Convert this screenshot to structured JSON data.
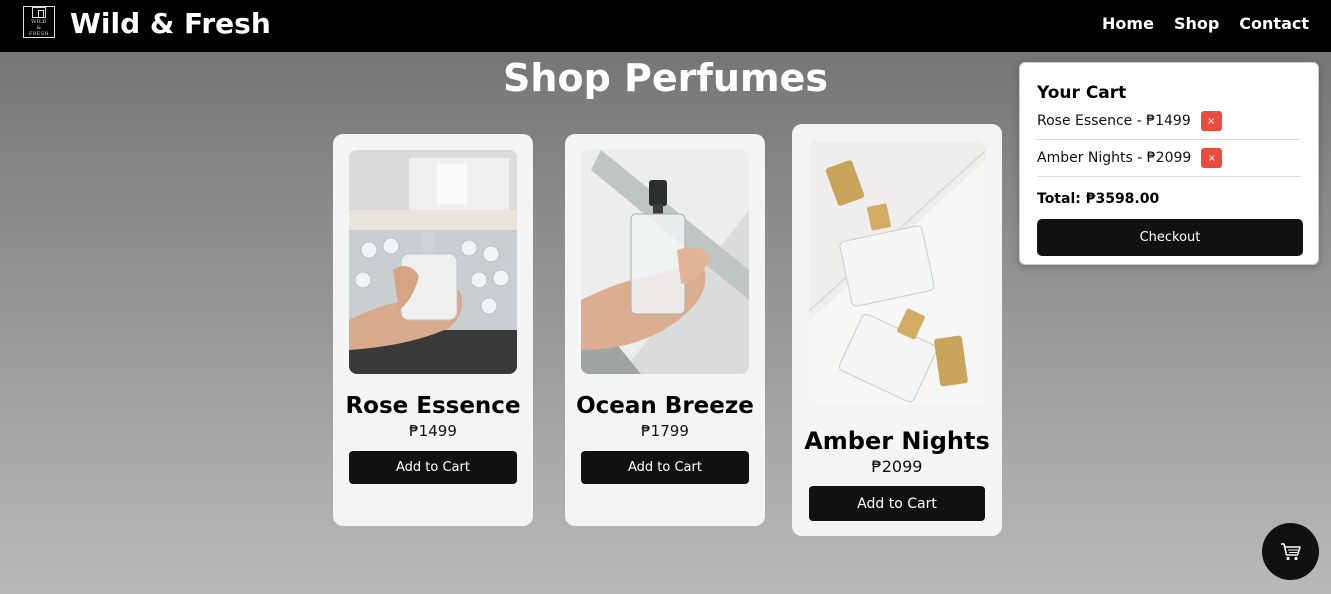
{
  "header": {
    "logo_text": "WILD\n&\nFRESH",
    "brand": "Wild & Fresh",
    "nav": [
      "Home",
      "Shop",
      "Contact"
    ]
  },
  "main": {
    "title": "Shop Perfumes",
    "products": [
      {
        "name": "Rose Essence",
        "price": "₱1499",
        "button": "Add to Cart"
      },
      {
        "name": "Ocean Breeze",
        "price": "₱1799",
        "button": "Add to Cart"
      },
      {
        "name": "Amber Nights",
        "price": "₱2099",
        "button": "Add to Cart"
      }
    ]
  },
  "cart": {
    "title": "Your Cart",
    "items": [
      {
        "label": "Rose Essence - ₱1499",
        "remove": "×"
      },
      {
        "label": "Amber Nights - ₱2099",
        "remove": "×"
      }
    ],
    "total": "Total: ₱3598.00",
    "checkout": "Checkout"
  },
  "fab": {
    "icon": "cart-icon"
  },
  "colors": {
    "header_bg": "#000000",
    "card_bg": "#f4f4f4",
    "button_bg": "#111111",
    "remove_bg": "#e74c3c"
  }
}
